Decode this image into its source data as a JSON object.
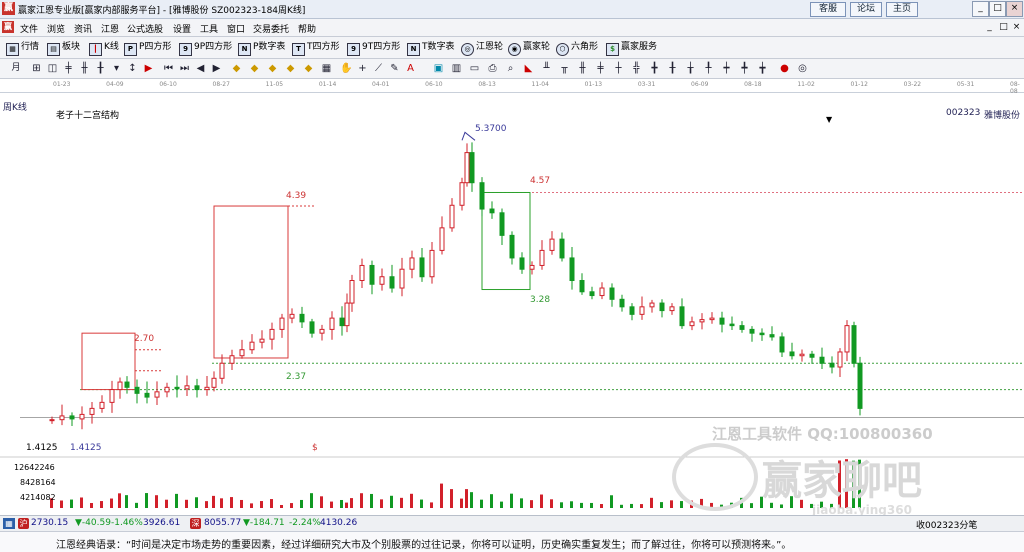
{
  "window": {
    "title": "赢家江恩专业版[赢家内部服务平台] - [雅博股份  SZ002323-184周K线]",
    "links": [
      "客服",
      "论坛",
      "主页"
    ],
    "controls": [
      "_",
      "□",
      "×"
    ]
  },
  "menu": {
    "items": [
      "文件",
      "浏览",
      "资讯",
      "江恩",
      "公式选股",
      "设置",
      "工具",
      "窗口",
      "交易委托",
      "帮助"
    ],
    "mdi_controls": [
      "_",
      "□",
      "×"
    ]
  },
  "toolbar1": {
    "items": [
      {
        "label": "行情",
        "icon": "grid-icon"
      },
      {
        "label": "板块",
        "icon": "blocks-icon"
      },
      {
        "label": "K线",
        "icon": "candle-icon"
      },
      {
        "label": "P四方形",
        "icon": "p4-icon"
      },
      {
        "label": "9P四方形",
        "icon": "9p4-icon"
      },
      {
        "label": "P数字表",
        "icon": "pn-icon"
      },
      {
        "label": "T四方形",
        "icon": "t4-icon"
      },
      {
        "label": "9T四方形",
        "icon": "9t4-icon"
      },
      {
        "label": "T数字表",
        "icon": "tn-icon"
      },
      {
        "label": "江恩轮",
        "icon": "wheel-icon"
      },
      {
        "label": "赢家轮",
        "icon": "wheel2-icon"
      },
      {
        "label": "六角形",
        "icon": "hex-icon"
      },
      {
        "label": "赢家服务",
        "icon": "dollar-icon"
      }
    ]
  },
  "toolbar2": {
    "period_label": "月"
  },
  "timeline": {
    "dates": [
      "01-23",
      "04-09",
      "06-10",
      "08-27",
      "11-05",
      "01-14",
      "04-01",
      "06-10",
      "08-13",
      "11-04",
      "01-13",
      "03-31",
      "06-09",
      "08-18",
      "11-02",
      "01-12",
      "03-22",
      "05-31",
      "08-08"
    ]
  },
  "chart": {
    "period_label": "周K线",
    "title": "老子十二宫结构",
    "stock_code": "002323",
    "stock_name": "雅博股份",
    "annotations": {
      "high": "5.3700",
      "box1_top": "2.70",
      "box2_top": "4.39",
      "box2_bottom": "2.37",
      "box3_top": "4.57",
      "box3_bottom": "3.28",
      "low": "1.4125",
      "low_left": "1.4125",
      "dollar": "$"
    },
    "volume_axis": [
      "12642246",
      "8428164",
      "4214082"
    ],
    "colors": {
      "up": "#d2202a",
      "down": "#119922",
      "box": "#d83a3a",
      "green_box": "#2aa02a",
      "pink_line": "#e07080",
      "green_line": "#40a040"
    },
    "watermark": {
      "tool": "江恩工具软件  QQ:100800360",
      "brand": "赢家聊吧",
      "url": "jiaoba.ying360"
    }
  },
  "chart_data": {
    "type": "candlestick",
    "title": "老子十二宫结构",
    "x": [
      "01-23",
      "04-09",
      "06-10",
      "08-27",
      "11-05",
      "01-14",
      "04-01",
      "06-10",
      "08-13",
      "11-04",
      "01-13",
      "03-31",
      "06-09",
      "08-18",
      "11-02",
      "01-12",
      "03-22",
      "05-31",
      "08-08"
    ],
    "key_levels": {
      "high": 5.37,
      "box1_top": 2.7,
      "box2_top": 4.39,
      "box2_bottom": 2.37,
      "box3_top": 4.57,
      "box3_bottom": 3.28,
      "low": 1.4125
    },
    "ylim": [
      1.2,
      5.6
    ],
    "volume_ticks": [
      12642246,
      8428164,
      4214082
    ]
  },
  "statusbar": {
    "sh_index": "2730.15",
    "sh_change": "▼-40.59",
    "sh_pct": "-1.46%",
    "sh_amount": "3926.61",
    "sz_index": "8055.77",
    "sz_change": "▼-184.71",
    "sz_pct": "-2.24%",
    "sz_amount": "4130.26",
    "right_text": "收002323分笔"
  },
  "quote": {
    "text": "江恩经典语录：“时间是决定市场走势的重要因素，经过详细研究大市及个别股票的过往记录，你将可以证明，历史确实重复发生；而了解过往，你将可以预测将来。”。"
  }
}
